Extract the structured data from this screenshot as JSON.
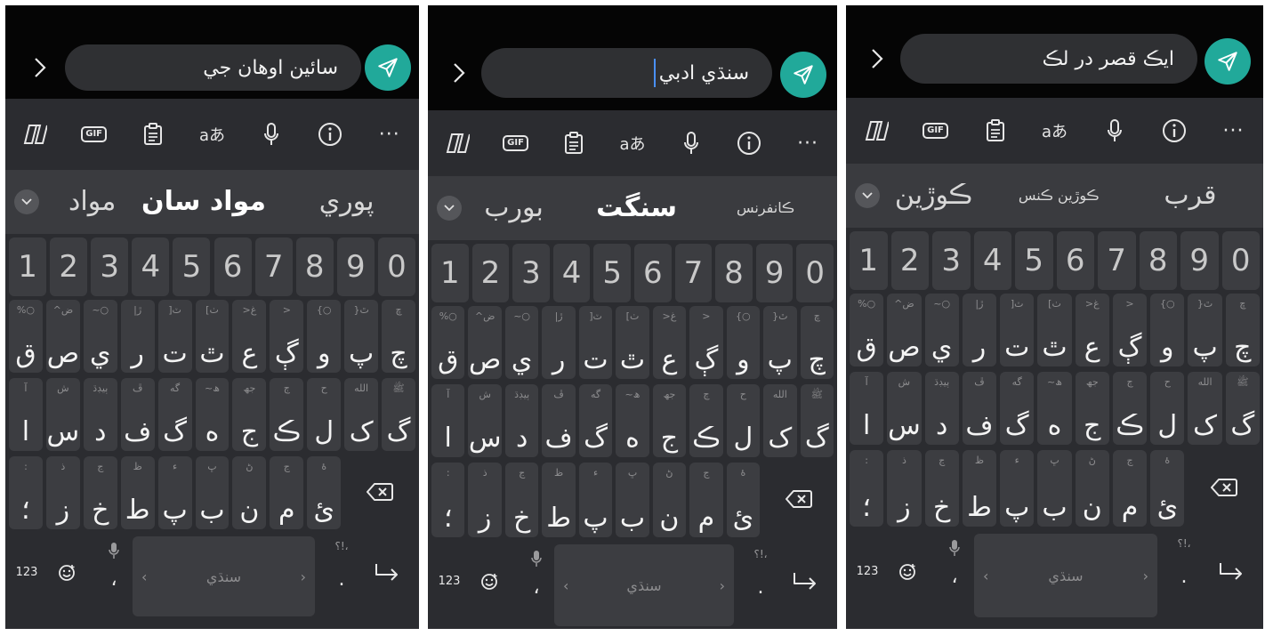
{
  "panels": [
    {
      "input_text": "سائين اوهان جي",
      "show_cursor": false,
      "suggestions": [
        "پوري",
        "مواد سان",
        "مواد"
      ],
      "suggestion_bold": 1
    },
    {
      "input_text": "سنڌي ادبي",
      "show_cursor": true,
      "suggestions": [
        "ڪانفرنس",
        "سنگت",
        "بورب"
      ],
      "suggestion_bold": 1
    },
    {
      "input_text": "ايڪ قصر در لڪ",
      "show_cursor": false,
      "suggestions": [
        "قرب",
        "ڪوڙين ڪنس",
        "ڪوڙين"
      ],
      "suggestion_bold": -1
    }
  ],
  "keyboard": {
    "number_row": [
      "1",
      "2",
      "3",
      "4",
      "5",
      "6",
      "7",
      "8",
      "9",
      "0"
    ],
    "row1": [
      {
        "main": "ق",
        "hint": "%○"
      },
      {
        "main": "ص",
        "hint": "^ض"
      },
      {
        "main": "ي",
        "hint": "~○"
      },
      {
        "main": "ر",
        "hint": "|ڙ"
      },
      {
        "main": "ت",
        "hint": "]ٽ"
      },
      {
        "main": "ٿ",
        "hint": "[ٺ"
      },
      {
        "main": "ع",
        "hint": ">غ"
      },
      {
        "main": "ڳ",
        "hint": ">"
      },
      {
        "main": "و",
        "hint": "{○"
      },
      {
        "main": "پ",
        "hint": "}ٿ"
      },
      {
        "main": "چ",
        "hint": "ڇ"
      }
    ],
    "row2": [
      {
        "main": "ا",
        "hint": "آ"
      },
      {
        "main": "س",
        "hint": "ش"
      },
      {
        "main": "د",
        "hint": "ٻيڊڌ"
      },
      {
        "main": "ف",
        "hint": "ڦ"
      },
      {
        "main": "گ",
        "hint": "گه"
      },
      {
        "main": "ه",
        "hint": "~ھ"
      },
      {
        "main": "ج",
        "hint": "جھ"
      },
      {
        "main": "ڪ",
        "hint": "ڄ"
      },
      {
        "main": "ل",
        "hint": "ح"
      },
      {
        "main": "ک",
        "hint": "الله"
      },
      {
        "main": "گ",
        "hint": "ﷺ"
      }
    ],
    "row3": [
      {
        "main": "؛",
        "hint": ":"
      },
      {
        "main": "ز",
        "hint": "ذ"
      },
      {
        "main": "خ",
        "hint": "ڃ"
      },
      {
        "main": "ط",
        "hint": "ظ"
      },
      {
        "main": "پ",
        "hint": "ء"
      },
      {
        "main": "ب",
        "hint": "ڀ"
      },
      {
        "main": "ن",
        "hint": "ڻ"
      },
      {
        "main": "م",
        "hint": "ڃ"
      },
      {
        "main": "ئ",
        "hint": "ۀ"
      }
    ],
    "label_123": "123",
    "space_label": "سنڌي",
    "comma": "،",
    "period": ".",
    "punct_hint": "؟!،",
    "gif_label": "GIF",
    "translate_label": "aあ",
    "more_label": "···"
  }
}
